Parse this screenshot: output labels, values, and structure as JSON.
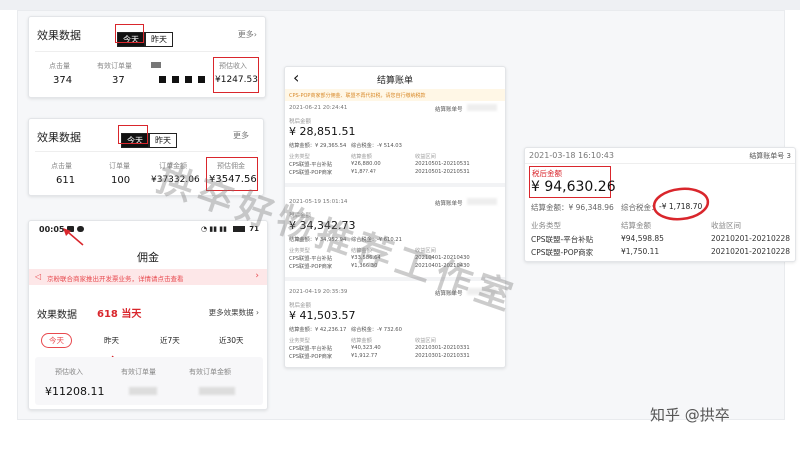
{
  "card1": {
    "title": "效果数据",
    "tab_today": "今天",
    "tab_yesterday": "昨天",
    "more": "更多",
    "more_arrow": "›",
    "stats": [
      {
        "label": "点击量",
        "value": "374"
      },
      {
        "label": "有效订单量",
        "value": "37"
      },
      {
        "label": "",
        "value": ""
      },
      {
        "label": "预估收入",
        "value": "¥1247.53"
      }
    ]
  },
  "card2": {
    "title": "效果数据",
    "tab_today": "今天",
    "tab_yesterday": "昨天",
    "more": "更多",
    "stats": [
      {
        "label": "点击量",
        "value": "611"
      },
      {
        "label": "订单量",
        "value": "100"
      },
      {
        "label": "订单金额",
        "value": "¥37332.06"
      },
      {
        "label": "预估佣金",
        "value": "¥3547.56"
      }
    ]
  },
  "phone": {
    "time": "00:05",
    "battery": "71",
    "title": "佣金",
    "banner": "京粉联合商家推出开发票业务，详情请点击查看",
    "banner_arrow": "›",
    "section_title": "效果数据",
    "annotation": "618 当天",
    "more": "更多效果数据",
    "more_arrow": "›",
    "tabs": [
      "今天",
      "昨天",
      "近7天",
      "近30天"
    ],
    "stats": [
      {
        "label": "预估收入",
        "value": "¥11208.11"
      },
      {
        "label": "有效订单量",
        "value": ""
      },
      {
        "label": "有效订单金额",
        "value": ""
      }
    ]
  },
  "settle": {
    "title": "结算账单",
    "back": "‹",
    "notice": "CPS-POP商家部分佣金、联盟不再代扣税，请您自行缴纳税款",
    "bill_no_label": "结算账单号",
    "entries": [
      {
        "date": "2021-06-21 20:24:41",
        "sub": "税后金额",
        "amount": "¥ 28,851.51",
        "pre_tax": "结算金额：¥ 29,365.54",
        "tax": "综合税金：-¥ 514.03",
        "col_type": "业务类型",
        "col_amount": "结算金额",
        "col_period": "收益区间",
        "rows": [
          {
            "type": "CPS联盟-平台补贴",
            "amount": "¥26,880.00",
            "period": "20210501-20210531"
          },
          {
            "type": "CPS联盟-POP商家",
            "amount": "¥1,8??.4?",
            "period": "20210501-20210531"
          }
        ]
      },
      {
        "date": "2021-05-19 15:01:14",
        "sub": "税后金额",
        "amount": "¥ 34,342.73",
        "pre_tax": "结算金额：¥ 34,952.94",
        "tax": "综合税金：-¥ 610.21",
        "col_type": "业务类型",
        "col_amount": "结算金额",
        "col_period": "收益区间",
        "rows": [
          {
            "type": "CPS联盟-平台补贴",
            "amount": "¥33,586.64",
            "period": "20210401-20210430"
          },
          {
            "type": "CPS联盟-POP商家",
            "amount": "¥1,366.30",
            "period": "20210401-20210430"
          }
        ]
      },
      {
        "date": "2021-04-19 20:35:39",
        "sub": "税后金额",
        "amount": "¥ 41,503.57",
        "pre_tax": "结算金额：¥ 42,236.17",
        "tax": "综合税金：-¥ 732.60",
        "col_type": "业务类型",
        "col_amount": "结算金额",
        "col_period": "收益区间",
        "rows": [
          {
            "type": "CPS联盟-平台补贴",
            "amount": "¥40,323.40",
            "period": "20210301-20210331"
          },
          {
            "type": "CPS联盟-POP商家",
            "amount": "¥1,912.77",
            "period": "20210301-20210331"
          }
        ]
      }
    ]
  },
  "detail": {
    "date": "2021-03-18 16:10:43",
    "bill_no": "结算账单号 3",
    "sub": "税后金额",
    "amount": "¥ 94,630.26",
    "pre_tax": "结算金额：¥ 96,348.96",
    "tax_label": "综合税金：",
    "tax": "-¥ 1,718.70",
    "col_type": "业务类型",
    "col_amount": "结算金额",
    "col_period": "收益区间",
    "rows": [
      {
        "type": "CPS联盟-平台补贴",
        "amount": "¥94,598.85",
        "period": "20210201-20210228"
      },
      {
        "type": "CPS联盟-POP商家",
        "amount": "¥1,750.11",
        "period": "20210201-20210228"
      }
    ]
  },
  "watermark": "拱卒好物推荐工作室",
  "brand": "知乎 @拱卒",
  "colors": {
    "accent_red": "#d9262c",
    "banner_bg": "#fde7e8",
    "pill_red": "#e84a4f"
  }
}
